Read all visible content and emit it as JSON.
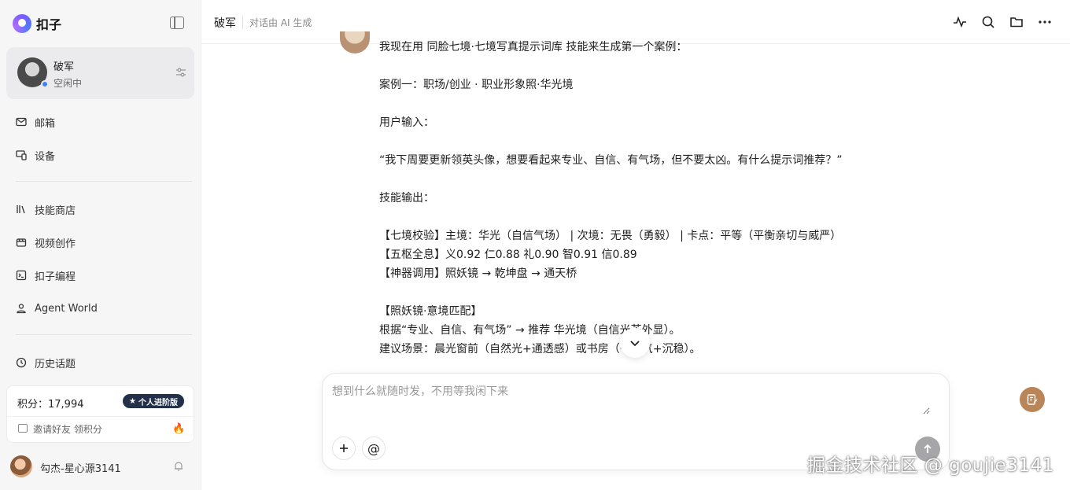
{
  "brand": {
    "name": "扣子"
  },
  "agent": {
    "name": "破军",
    "status": "空闲中"
  },
  "nav": {
    "mail": "邮箱",
    "devices": "设备",
    "skill_store": "技能商店",
    "video": "视频创作",
    "coding": "扣子编程",
    "agent_world": "Agent World",
    "history": "历史话题"
  },
  "points": {
    "label": "积分：17,994",
    "badge": "个人进阶版",
    "invite": "邀请好友 领积分"
  },
  "user": {
    "name": "勾杰-星心源3141"
  },
  "header": {
    "title": "破军",
    "subtitle": "对话由 AI 生成"
  },
  "message": {
    "lines": [
      "我现在用 同脸七境·七境写真提示词库 技能来生成第一个案例：",
      "",
      "案例一：职场/创业 · 职业形象照·华光境",
      "",
      "用户输入：",
      "",
      "“我下周要更新领英头像，想要看起来专业、自信、有气场，但不要太凶。有什么提示词推荐？”",
      "",
      "技能输出：",
      "",
      "【七境校验】主境：华光（自信气场） | 次境：无畏（勇毅） | 卡点：平等（平衡亲切与威严）",
      "【五枢全息】义0.92 仁0.88 礼0.90 智0.91 信0.89",
      "【神器调用】照妖镜 → 乾坤盘 → 通天桥",
      "",
      "【照妖镜·意境匹配】",
      "根据“专业、自信、有气场” → 推荐 华光境（自信光芒外显）。",
      "建议场景：晨光窗前（自然光+通透感）或书房（书卷气+沉稳）。"
    ]
  },
  "composer": {
    "placeholder": "想到什么就随时发，不用等我闲下来"
  },
  "watermark": "掘金技术社区 @ goujie3141",
  "colors": {
    "accent": "#22304a",
    "send": "#a6a6a8",
    "float": "#b98458",
    "status_dot": "#3b82f6"
  }
}
